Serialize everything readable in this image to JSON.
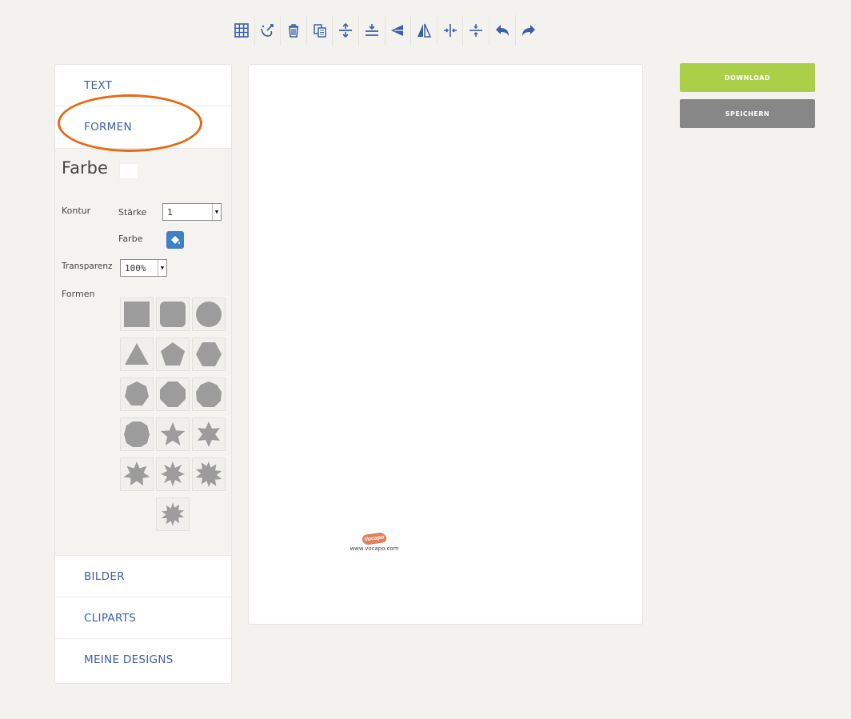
{
  "toolbar": {
    "tools": [
      {
        "icon": "grid-icon",
        "label": ""
      },
      {
        "icon": "clear-icon",
        "label": ""
      },
      {
        "icon": "trash-icon",
        "label": ""
      },
      {
        "icon": "copy-icon",
        "label": ""
      },
      {
        "icon": "align-top-icon",
        "label": ""
      },
      {
        "icon": "align-middle-icon",
        "label": ""
      },
      {
        "icon": "arrow-left-icon",
        "label": ""
      },
      {
        "icon": "flip-horizontal-icon",
        "label": ""
      },
      {
        "icon": "center-horizontal-icon",
        "label": ""
      },
      {
        "icon": "center-vertical-icon",
        "label": ""
      },
      {
        "icon": "undo-icon",
        "label": ""
      },
      {
        "icon": "redo-icon",
        "label": ""
      }
    ],
    "color": "#3a5ea8"
  },
  "sidebar": {
    "sections": {
      "text": "TEXT",
      "formen": "FORMEN",
      "bilder": "BILDER",
      "cliparts": "CLIPARTS",
      "meine_designs": "MEINE DESIGNS"
    },
    "formen_panel": {
      "farbe_title": "Farbe",
      "kontur_label": "Kontur",
      "staerke_label": "Stärke",
      "staerke_value": "1",
      "kontur_farbe_label": "Farbe",
      "transparenz_label": "Transparenz",
      "transparenz_value": "100%",
      "formen_label": "Formen",
      "shapes": [
        "square",
        "rounded-square",
        "circle",
        "triangle",
        "pentagon",
        "hexagon",
        "heptagon",
        "octagon",
        "nonagon",
        "decagon",
        "star-5",
        "star-6",
        "star-7",
        "star-8",
        "star-9",
        "star-10"
      ]
    },
    "link_color": "#3f5fa9"
  },
  "canvas": {
    "logo_text": "Vocapo",
    "logo_url": "www.vocapo.com"
  },
  "actions": {
    "download": "DOWNLOAD",
    "save": "SPEICHERN",
    "download_color": "#abcf49",
    "save_color": "#878787"
  },
  "annotation": {
    "highlight_color": "#e56a15"
  }
}
